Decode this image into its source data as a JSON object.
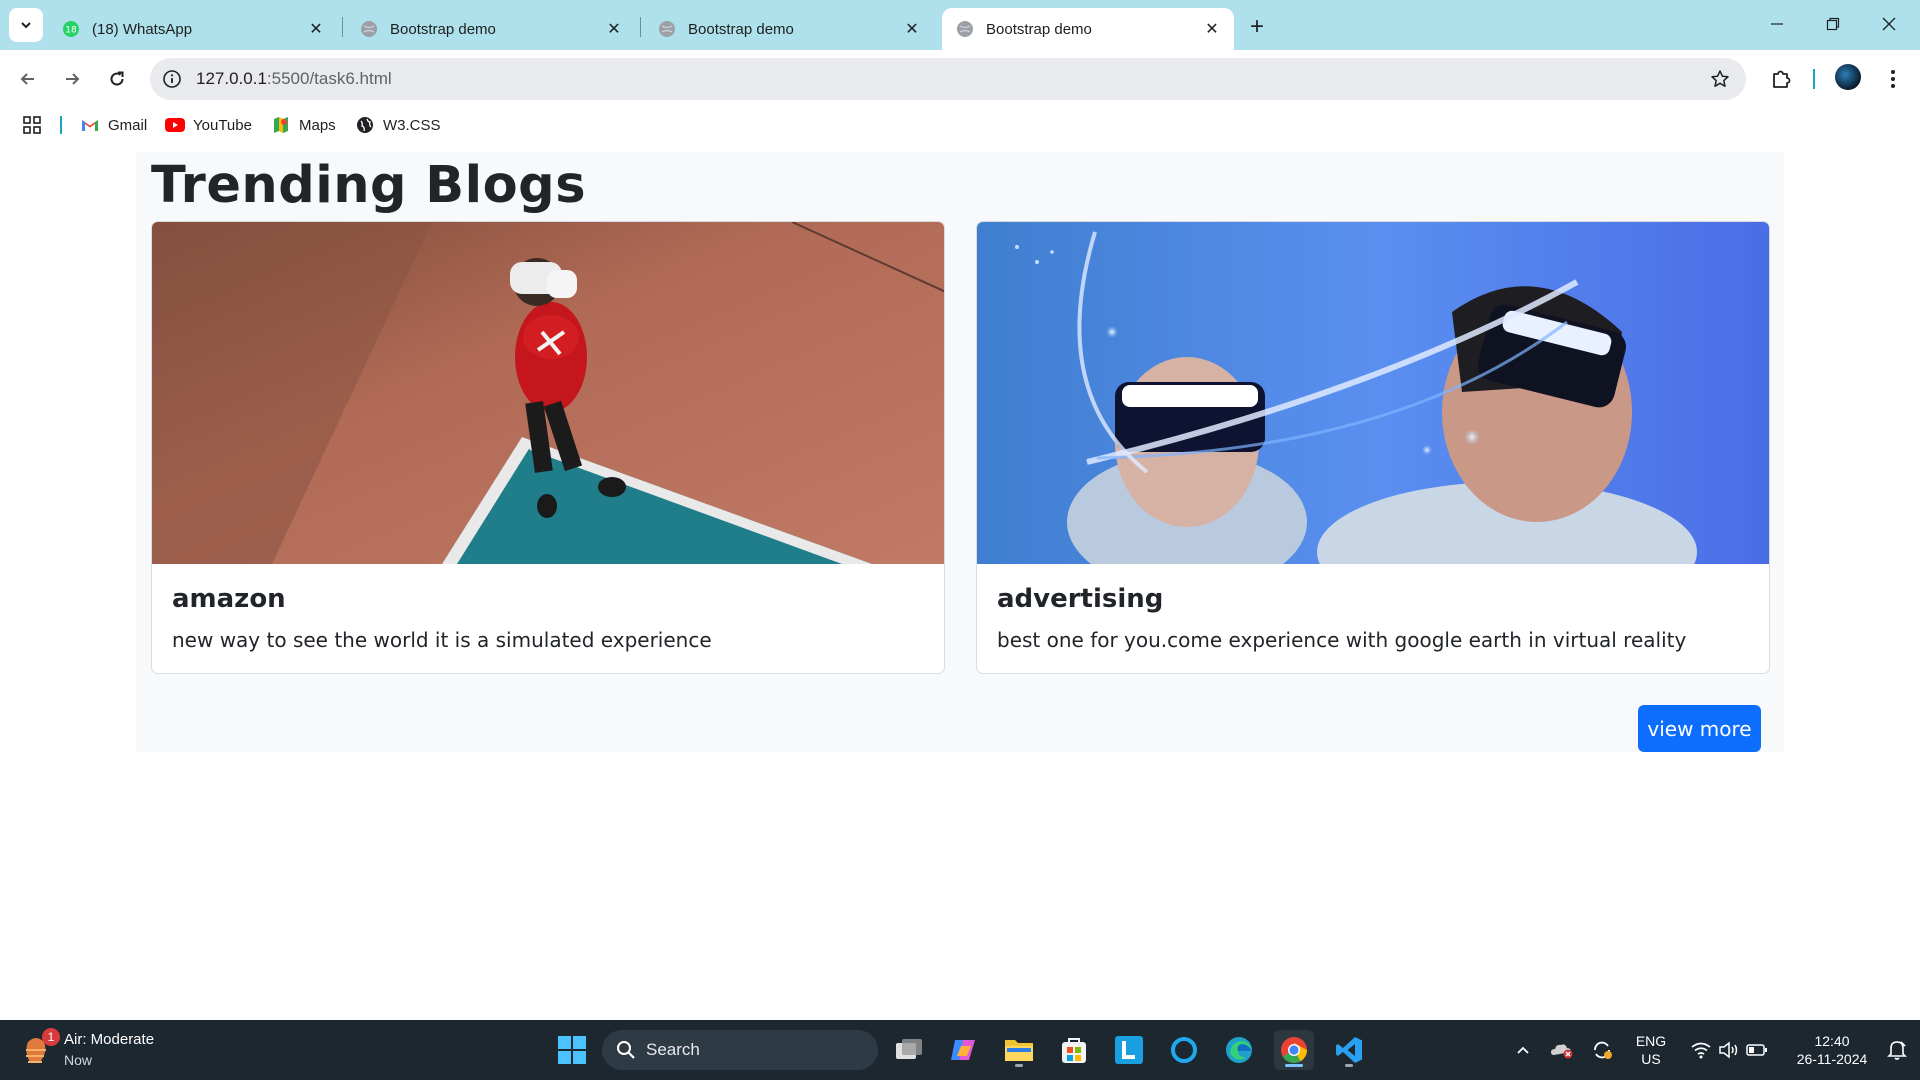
{
  "browser": {
    "tabs": [
      {
        "title": "(18) WhatsApp",
        "badge": "18",
        "active": false
      },
      {
        "title": "Bootstrap demo",
        "active": false
      },
      {
        "title": "Bootstrap demo",
        "active": false
      },
      {
        "title": "Bootstrap demo",
        "active": true
      }
    ],
    "url_host": "127.0.0.1",
    "url_path": ":5500/task6.html",
    "accent": "#aee1ec"
  },
  "bookmarks": [
    {
      "label": "Gmail",
      "icon": "gmail-icon"
    },
    {
      "label": "YouTube",
      "icon": "youtube-icon"
    },
    {
      "label": "Maps",
      "icon": "maps-icon"
    },
    {
      "label": "W3.CSS",
      "icon": "globe-icon"
    }
  ],
  "page": {
    "heading": "Trending Blogs",
    "cards": [
      {
        "title": "amazon",
        "text": "new way to see the world it is a simulated experience",
        "image": "person-in-vr-headset-photo"
      },
      {
        "title": "advertising",
        "text": "best one for you.come experience with google earth in virtual reality",
        "image": "two-people-vr-headsets-photo"
      }
    ],
    "button": "view more",
    "button_color": "#0d6efd"
  },
  "taskbar": {
    "weather_title": "Air: Moderate",
    "weather_sub": "Now",
    "weather_badge": "1",
    "search_label": "Search",
    "lang_top": "ENG",
    "lang_bottom": "US",
    "time": "12:40",
    "date": "26-11-2024"
  }
}
